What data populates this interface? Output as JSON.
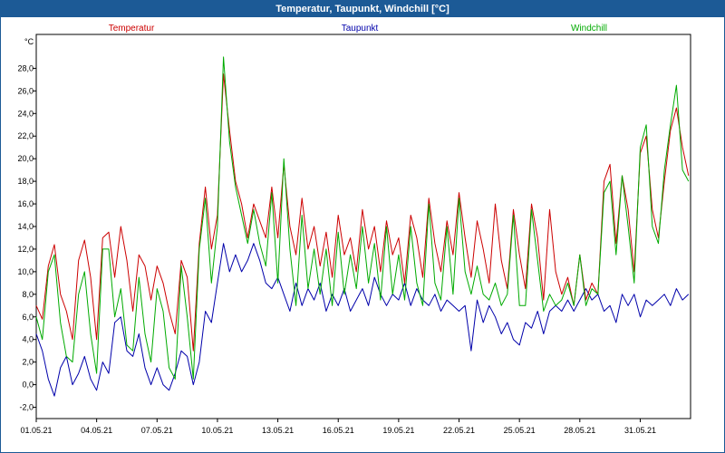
{
  "window": {
    "title": "Temperatur, Taupunkt, Windchill [°C]"
  },
  "chart_data": {
    "type": "line",
    "title": "Temperatur, Taupunkt, Windchill [°C]",
    "ylabel": "°C",
    "xlabel": "",
    "ylim": [
      -3,
      31
    ],
    "xlim": [
      0,
      32.5
    ],
    "grid": true,
    "legend_placement": "top",
    "x_tick_labels": [
      "01.05.21",
      "04.05.21",
      "07.05.21",
      "10.05.21",
      "13.05.21",
      "16.05.21",
      "19.05.21",
      "22.05.21",
      "25.05.21",
      "28.05.21",
      "31.05.21"
    ],
    "x_tick_values": [
      0,
      3,
      6,
      9,
      12,
      15,
      18,
      21,
      24,
      27,
      30
    ],
    "y_tick_labels": [
      "-2,0",
      "0,0",
      "2,0",
      "4,0",
      "6,0",
      "8,0",
      "10,0",
      "12,0",
      "14,0",
      "16,0",
      "18,0",
      "20,0",
      "22,0",
      "24,0",
      "26,0",
      "28,0"
    ],
    "y_tick_values": [
      -2,
      0,
      2,
      4,
      6,
      8,
      10,
      12,
      14,
      16,
      18,
      20,
      22,
      24,
      26,
      28
    ],
    "series": [
      {
        "name": "Temperatur",
        "color": "#cc0000",
        "x": [
          0,
          0.3,
          0.6,
          0.9,
          1.2,
          1.5,
          1.8,
          2.1,
          2.4,
          2.7,
          3.0,
          3.3,
          3.6,
          3.9,
          4.2,
          4.5,
          4.8,
          5.1,
          5.4,
          5.7,
          6.0,
          6.3,
          6.6,
          6.9,
          7.2,
          7.5,
          7.8,
          8.1,
          8.4,
          8.7,
          9.0,
          9.3,
          9.6,
          9.9,
          10.2,
          10.5,
          10.8,
          11.1,
          11.4,
          11.7,
          12.0,
          12.3,
          12.6,
          12.9,
          13.2,
          13.5,
          13.8,
          14.1,
          14.4,
          14.7,
          15.0,
          15.3,
          15.6,
          15.9,
          16.2,
          16.5,
          16.8,
          17.1,
          17.4,
          17.7,
          18.0,
          18.3,
          18.6,
          18.9,
          19.2,
          19.5,
          19.8,
          20.1,
          20.4,
          20.7,
          21.0,
          21.3,
          21.6,
          21.9,
          22.2,
          22.5,
          22.8,
          23.1,
          23.4,
          23.7,
          24.0,
          24.3,
          24.6,
          24.9,
          25.2,
          25.5,
          25.8,
          26.1,
          26.4,
          26.7,
          27.0,
          27.3,
          27.6,
          27.9,
          28.2,
          28.5,
          28.8,
          29.1,
          29.4,
          29.7,
          30.0,
          30.3,
          30.6,
          30.9,
          31.2,
          31.5,
          31.8,
          32.1,
          32.4
        ],
        "values": [
          7.0,
          5.8,
          10.5,
          12.4,
          8.0,
          6.5,
          4.0,
          11.0,
          12.8,
          9.5,
          4.0,
          13.0,
          13.5,
          9.5,
          14.0,
          11.0,
          6.5,
          11.5,
          10.5,
          7.5,
          10.5,
          9.0,
          6.5,
          4.5,
          11.0,
          9.5,
          3.0,
          12.5,
          17.5,
          12.0,
          15.0,
          27.5,
          22.5,
          18.0,
          16.0,
          13.0,
          16.0,
          14.5,
          13.0,
          17.5,
          13.0,
          19.5,
          14.0,
          11.5,
          16.5,
          12.0,
          14.0,
          10.5,
          13.5,
          9.5,
          15.0,
          11.5,
          13.0,
          10.0,
          15.5,
          12.0,
          14.0,
          10.0,
          14.5,
          11.5,
          13.0,
          9.0,
          15.0,
          13.0,
          9.5,
          16.5,
          12.5,
          10.0,
          14.5,
          11.5,
          17.0,
          13.0,
          9.5,
          14.5,
          12.0,
          9.0,
          16.0,
          11.0,
          8.5,
          15.5,
          11.5,
          8.5,
          16.0,
          13.0,
          7.5,
          15.5,
          10.0,
          8.0,
          9.5,
          7.0,
          11.5,
          7.5,
          9.0,
          8.0,
          18.0,
          19.5,
          12.5,
          18.5,
          15.5,
          10.0,
          20.5,
          22.0,
          15.5,
          13.0,
          18.0,
          22.5,
          24.5,
          21.0,
          18.5
        ]
      },
      {
        "name": "Taupunkt",
        "color": "#0000aa",
        "x": [
          0,
          0.3,
          0.6,
          0.9,
          1.2,
          1.5,
          1.8,
          2.1,
          2.4,
          2.7,
          3.0,
          3.3,
          3.6,
          3.9,
          4.2,
          4.5,
          4.8,
          5.1,
          5.4,
          5.7,
          6.0,
          6.3,
          6.6,
          6.9,
          7.2,
          7.5,
          7.8,
          8.1,
          8.4,
          8.7,
          9.0,
          9.3,
          9.6,
          9.9,
          10.2,
          10.5,
          10.8,
          11.1,
          11.4,
          11.7,
          12.0,
          12.3,
          12.6,
          12.9,
          13.2,
          13.5,
          13.8,
          14.1,
          14.4,
          14.7,
          15.0,
          15.3,
          15.6,
          15.9,
          16.2,
          16.5,
          16.8,
          17.1,
          17.4,
          17.7,
          18.0,
          18.3,
          18.6,
          18.9,
          19.2,
          19.5,
          19.8,
          20.1,
          20.4,
          20.7,
          21.0,
          21.3,
          21.6,
          21.9,
          22.2,
          22.5,
          22.8,
          23.1,
          23.4,
          23.7,
          24.0,
          24.3,
          24.6,
          24.9,
          25.2,
          25.5,
          25.8,
          26.1,
          26.4,
          26.7,
          27.0,
          27.3,
          27.6,
          27.9,
          28.2,
          28.5,
          28.8,
          29.1,
          29.4,
          29.7,
          30.0,
          30.3,
          30.6,
          30.9,
          31.2,
          31.5,
          31.8,
          32.1,
          32.4
        ],
        "values": [
          4.5,
          3.0,
          0.5,
          -1.0,
          1.5,
          2.5,
          0.0,
          1.0,
          2.5,
          0.5,
          -0.5,
          2.0,
          1.0,
          5.5,
          6.0,
          3.0,
          2.5,
          4.5,
          1.5,
          0.0,
          1.5,
          0.0,
          -0.5,
          1.0,
          3.0,
          2.5,
          0.0,
          2.0,
          6.5,
          5.5,
          9.0,
          12.5,
          10.0,
          11.5,
          10.0,
          11.0,
          12.5,
          11.0,
          9.0,
          8.5,
          9.5,
          8.0,
          6.5,
          9.0,
          7.0,
          8.5,
          7.5,
          9.0,
          6.5,
          8.0,
          7.0,
          8.5,
          6.5,
          7.5,
          8.5,
          7.0,
          9.5,
          8.0,
          7.0,
          8.0,
          7.5,
          9.0,
          7.0,
          8.5,
          7.5,
          7.0,
          8.0,
          6.5,
          7.5,
          7.0,
          6.5,
          7.0,
          3.0,
          7.5,
          5.5,
          7.0,
          6.0,
          4.5,
          5.5,
          4.0,
          3.5,
          5.5,
          5.0,
          6.5,
          4.5,
          6.5,
          7.0,
          6.5,
          7.5,
          6.5,
          7.5,
          8.5,
          7.5,
          8.0,
          6.5,
          7.0,
          5.5,
          8.0,
          7.0,
          8.0,
          6.0,
          7.5,
          7.0,
          7.5,
          8.0,
          7.0,
          8.5,
          7.5,
          8.0
        ]
      },
      {
        "name": "Windchill",
        "color": "#00aa00",
        "x": [
          0,
          0.3,
          0.6,
          0.9,
          1.2,
          1.5,
          1.8,
          2.1,
          2.4,
          2.7,
          3.0,
          3.3,
          3.6,
          3.9,
          4.2,
          4.5,
          4.8,
          5.1,
          5.4,
          5.7,
          6.0,
          6.3,
          6.6,
          6.9,
          7.2,
          7.5,
          7.8,
          8.1,
          8.4,
          8.7,
          9.0,
          9.3,
          9.6,
          9.9,
          10.2,
          10.5,
          10.8,
          11.1,
          11.4,
          11.7,
          12.0,
          12.3,
          12.6,
          12.9,
          13.2,
          13.5,
          13.8,
          14.1,
          14.4,
          14.7,
          15.0,
          15.3,
          15.6,
          15.9,
          16.2,
          16.5,
          16.8,
          17.1,
          17.4,
          17.7,
          18.0,
          18.3,
          18.6,
          18.9,
          19.2,
          19.5,
          19.8,
          20.1,
          20.4,
          20.7,
          21.0,
          21.3,
          21.6,
          21.9,
          22.2,
          22.5,
          22.8,
          23.1,
          23.4,
          23.7,
          24.0,
          24.3,
          24.6,
          24.9,
          25.2,
          25.5,
          25.8,
          26.1,
          26.4,
          26.7,
          27.0,
          27.3,
          27.6,
          27.9,
          28.2,
          28.5,
          28.8,
          29.1,
          29.4,
          29.7,
          30.0,
          30.3,
          30.6,
          30.9,
          31.2,
          31.5,
          31.8,
          32.1,
          32.4
        ],
        "values": [
          6.0,
          4.0,
          10.0,
          11.5,
          5.5,
          2.5,
          2.0,
          8.0,
          10.0,
          4.5,
          1.0,
          12.0,
          12.0,
          6.0,
          8.5,
          3.5,
          3.0,
          9.5,
          4.5,
          2.0,
          8.5,
          6.5,
          1.5,
          0.5,
          10.5,
          6.0,
          0.5,
          12.0,
          16.5,
          9.0,
          14.0,
          29.0,
          21.5,
          17.5,
          15.0,
          12.5,
          15.5,
          12.5,
          10.5,
          17.0,
          9.0,
          20.0,
          12.0,
          7.0,
          15.0,
          8.5,
          12.0,
          8.0,
          12.0,
          7.0,
          13.5,
          8.0,
          11.5,
          8.5,
          14.0,
          9.0,
          12.5,
          7.5,
          14.0,
          8.0,
          11.5,
          7.5,
          14.0,
          9.0,
          7.0,
          16.0,
          9.0,
          7.5,
          14.0,
          8.0,
          16.5,
          10.0,
          8.0,
          10.5,
          8.0,
          7.5,
          9.0,
          7.0,
          8.0,
          15.0,
          7.0,
          7.0,
          15.5,
          11.0,
          6.5,
          8.0,
          7.0,
          7.5,
          9.0,
          7.0,
          11.5,
          7.0,
          8.5,
          8.0,
          17.0,
          18.0,
          11.5,
          18.5,
          14.0,
          9.0,
          21.0,
          23.0,
          14.0,
          12.5,
          19.0,
          23.0,
          26.5,
          19.0,
          18.0
        ]
      }
    ]
  }
}
